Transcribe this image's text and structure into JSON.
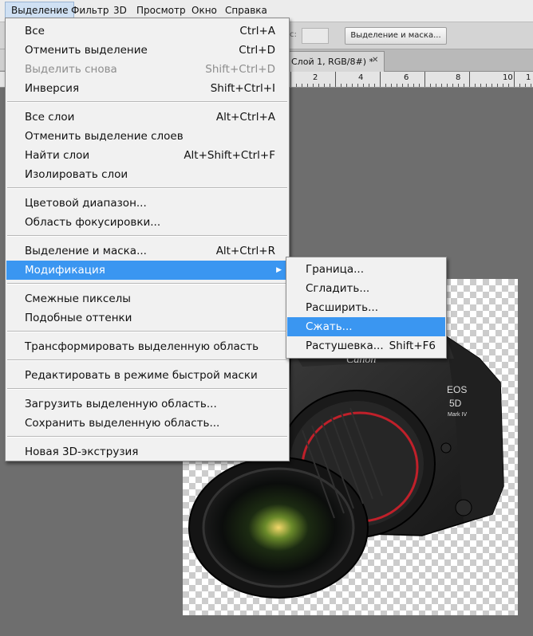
{
  "menubar": {
    "items": [
      "Выделение",
      "Фильтр",
      "3D",
      "Просмотр",
      "Окно",
      "Справка"
    ]
  },
  "options_bar": {
    "label_fragment": "с:",
    "button_label": "Выделение и маска..."
  },
  "document_tab": {
    "title": "Слой 1, RGB/8#) *",
    "close": "✕"
  },
  "ruler": {
    "numbers": [
      "2",
      "4",
      "6",
      "8",
      "10",
      "1"
    ]
  },
  "menu": {
    "items": [
      {
        "label": "Все",
        "shortcut": "Ctrl+A"
      },
      {
        "label": "Отменить выделение",
        "shortcut": "Ctrl+D"
      },
      {
        "label": "Выделить снова",
        "shortcut": "Shift+Ctrl+D",
        "disabled": true
      },
      {
        "label": "Инверсия",
        "shortcut": "Shift+Ctrl+I"
      },
      {
        "label": "Все слои",
        "shortcut": "Alt+Ctrl+A"
      },
      {
        "label": "Отменить выделение слоев",
        "shortcut": ""
      },
      {
        "label": "Найти слои",
        "shortcut": "Alt+Shift+Ctrl+F"
      },
      {
        "label": "Изолировать слои",
        "shortcut": ""
      },
      {
        "label": "Цветовой диапазон...",
        "shortcut": ""
      },
      {
        "label": "Область фокусировки...",
        "shortcut": ""
      },
      {
        "label": "Выделение и маска...",
        "shortcut": "Alt+Ctrl+R"
      },
      {
        "label": "Модификация",
        "shortcut": "",
        "submenu": true,
        "highlighted": true
      },
      {
        "label": "Смежные пикселы",
        "shortcut": ""
      },
      {
        "label": "Подобные оттенки",
        "shortcut": ""
      },
      {
        "label": "Трансформировать выделенную область",
        "shortcut": ""
      },
      {
        "label": "Редактировать в режиме быстрой маски",
        "shortcut": ""
      },
      {
        "label": "Загрузить выделенную область...",
        "shortcut": ""
      },
      {
        "label": "Сохранить выделенную область...",
        "shortcut": ""
      },
      {
        "label": "Новая 3D-экструзия",
        "shortcut": ""
      }
    ]
  },
  "submenu": {
    "items": [
      {
        "label": "Граница...",
        "shortcut": ""
      },
      {
        "label": "Сгладить...",
        "shortcut": ""
      },
      {
        "label": "Расширить...",
        "shortcut": ""
      },
      {
        "label": "Сжать...",
        "shortcut": "",
        "highlighted": true
      },
      {
        "label": "Растушевка...",
        "shortcut": "Shift+F6"
      }
    ]
  },
  "camera": {
    "brand": "Canon",
    "model_line1": "EOS",
    "model_line2": "5D",
    "model_line3": "Mark IV"
  },
  "colors": {
    "highlight": "#3a96f1",
    "menu_bg": "#f1f1f1",
    "workspace": "#6e6e6e"
  }
}
